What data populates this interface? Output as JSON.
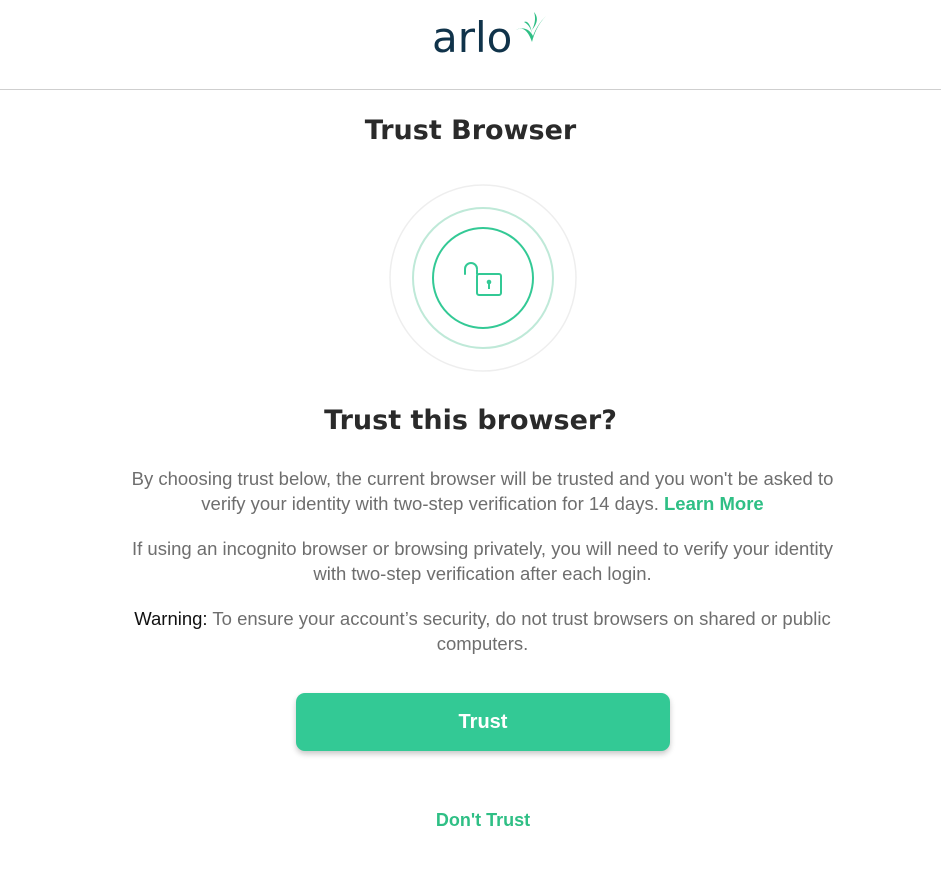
{
  "header": {
    "logo_text": "arlo",
    "logo_icon": "bird-icon"
  },
  "page": {
    "title": "Trust Browser",
    "illustration_icon": "unlocked-padlock-icon",
    "question": "Trust this browser?",
    "paragraph1_text": "By choosing trust below, the current browser will be trusted and you won't be asked to verify your identity with two-step verification for 14 days.",
    "learn_more_label": "Learn More",
    "paragraph2_text": "If using an incognito browser or browsing privately, you will need to verify your identity with two-step verification after each login.",
    "warning_label": "Warning:",
    "warning_text": "To ensure your account’s security, do not trust browsers on shared or public computers."
  },
  "actions": {
    "trust_label": "Trust",
    "dont_trust_label": "Don't Trust"
  },
  "colors": {
    "accent": "#33c995",
    "link": "#2fbf85",
    "logo_text": "#10334a",
    "body_text": "#6e6e6e",
    "heading_text": "#2a2a2a"
  }
}
